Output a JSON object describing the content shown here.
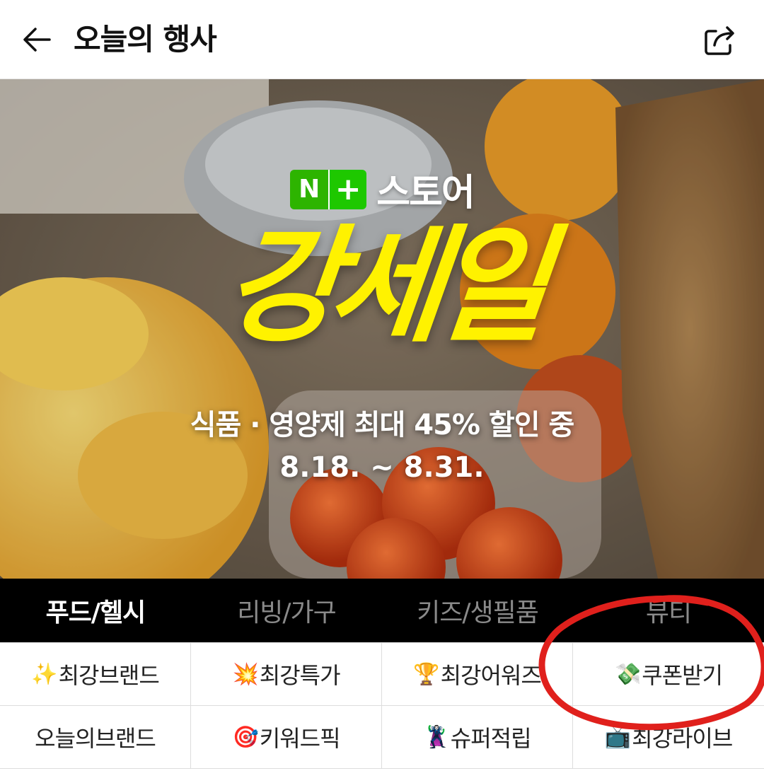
{
  "header": {
    "title": "오늘의 행사",
    "back_icon": "arrow-left-icon",
    "share_icon": "share-icon"
  },
  "banner": {
    "logo_n": "N",
    "logo_plus": "+",
    "logo_text": "스토어",
    "headline": "강세일",
    "subline": "식품 · 영양제 최대 45% 할인 중",
    "dates": "8.18. ~ 8.31.",
    "headline_color": "#fff200",
    "brand_green": "#2db400"
  },
  "tabs": [
    {
      "label": "푸드/헬시",
      "active": true
    },
    {
      "label": "리빙/가구",
      "active": false
    },
    {
      "label": "키즈/생필품",
      "active": false
    },
    {
      "label": "뷰티",
      "active": false
    }
  ],
  "menu": [
    {
      "emoji": "✨",
      "label": "최강브랜드",
      "icon": "sparkles-icon"
    },
    {
      "emoji": "💥",
      "label": "최강특가",
      "icon": "collision-icon"
    },
    {
      "emoji": "🏆",
      "label": "최강어워즈",
      "icon": "trophy-icon"
    },
    {
      "emoji": "💸",
      "label": "쿠폰받기",
      "icon": "money-wings-icon"
    },
    {
      "emoji": "",
      "label": "오늘의브랜드",
      "icon": ""
    },
    {
      "emoji": "🎯",
      "label": "키워드픽",
      "icon": "target-icon"
    },
    {
      "emoji": "🦹",
      "label": "슈퍼적립",
      "icon": "supervillain-icon"
    },
    {
      "emoji": "📺",
      "label": "최강라이브",
      "icon": "tv-icon"
    }
  ],
  "annotation_color": "#e0201c"
}
